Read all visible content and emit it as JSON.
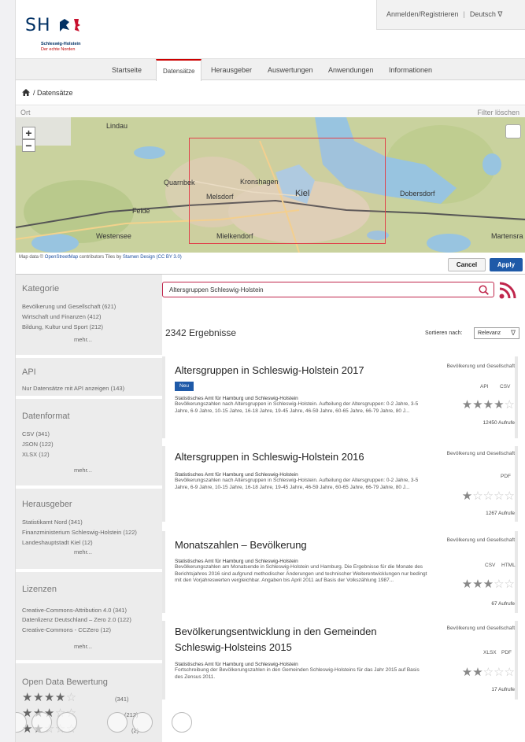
{
  "header": {
    "logo_text": "SH",
    "logo_line1": "Schleswig-Holstein",
    "logo_line2": "Der echte Norden",
    "login": "Anmelden/Registrieren",
    "separator": "|",
    "language": "Deutsch ∇"
  },
  "nav": [
    "Startseite",
    "Datensätze",
    "Herausgeber",
    "Auswertungen",
    "Anwendungen",
    "Informationen"
  ],
  "breadcrumb": "/ Datensätze",
  "map": {
    "label": "Ort",
    "clear": "Filter löschen",
    "zoom_in": "+",
    "zoom_out": "−",
    "places": [
      "Lindau",
      "Quarnbek",
      "Kronshagen",
      "Melsdorf",
      "Kiel",
      "Dobersdorf",
      "Felde",
      "Westensee",
      "Mielkendorf",
      "Martensra"
    ],
    "attribution_pre": "Map data © ",
    "attribution_osm": "OpenStreetMap",
    "attribution_mid": " contributors   Tiles by ",
    "attribution_stamen": "Stamen Design",
    "attribution_cc": " (CC BY 3.0)",
    "cancel": "Cancel",
    "apply": "Apply"
  },
  "sidebar": {
    "kategorie": {
      "title": "Kategorie",
      "items": [
        "Bevölkerung und Gesellschaft (621)",
        "Wirtschaft und Finanzen (412)",
        "Bildung, Kultur und Sport (212)"
      ],
      "more": "mehr..."
    },
    "api": {
      "title": "API",
      "items": [
        "Nur Datensätze mit API anzeigen (143)"
      ]
    },
    "datenformat": {
      "title": "Datenformat",
      "items": [
        "CSV (341)",
        "JSON (122)",
        "XLSX (12)"
      ],
      "more": "mehr..."
    },
    "herausgeber": {
      "title": "Herausgeber",
      "items": [
        "Statistikamt Nord (341)",
        "Finanzministerium Schleswig-Holstein (122)",
        "Landeshauptstadt Kiel (12)"
      ],
      "more": "mehr..."
    },
    "lizenzen": {
      "title": "Lizenzen",
      "items": [
        "Creative-Commons-Attribution 4.0 (341)",
        "Datenlizenz Deutschland – Zero 2.0 (122)",
        "Creative-Commons - CCZero (12)"
      ],
      "more": "mehr..."
    },
    "bewertung": {
      "title": "Open Data Bewertung",
      "rows": [
        {
          "stars": 4,
          "count": "(341)"
        },
        {
          "stars": 3,
          "count": "(212)"
        },
        {
          "stars": 2,
          "count": "(2)"
        }
      ]
    }
  },
  "search": {
    "value": "Altersgruppen Schleswig-Holstein"
  },
  "results_count": "2342 Ergebnisse",
  "sort": {
    "label": "Sortieren nach:",
    "value": "Relevanz",
    "arrow": "∇"
  },
  "results": [
    {
      "title": "Altersgruppen in Schleswig-Holstein 2017",
      "badge": "Neu",
      "publisher": "Statistisches Amt für Hamburg und Schleswig-Holstein",
      "description": "Bevölkerungszahlen nach Altersgruppen in Schleswig-Holstein. Aufteilung der Altersgruppen: 0-2 Jahre, 3-5 Jahre, 6-9 Jahre, 10-15 Jahre, 16-18 Jahre, 19-45 Jahre, 46-59 Jahre, 60-65 Jahre, 66-79 Jahre, 80 J...",
      "category": "Bevölkerung und Gesellschaft",
      "formats": [
        "API",
        "CSV"
      ],
      "rating": 4,
      "views": "12450 Aufrufe"
    },
    {
      "title": "Altersgruppen in Schleswig-Holstein 2016",
      "publisher": "Statistisches Amt für Hamburg und Schleswig-Holstein",
      "description": "Bevölkerungszahlen nach Altersgruppen in Schleswig-Holstein. Aufteilung der Altersgruppen: 0-2 Jahre, 3-5 Jahre, 6-9 Jahre, 10-15 Jahre, 16-18 Jahre, 19-45 Jahre, 46-59 Jahre, 60-65 Jahre, 66-79 Jahre, 80 J...",
      "category": "Bevölkerung und Gesellschaft",
      "formats": [
        "PDF"
      ],
      "rating": 1,
      "views": "1267 Aufrufe"
    },
    {
      "title": "Monatszahlen – Bevölkerung",
      "publisher": "Statistisches Amt für Hamburg und Schleswig-Holstein",
      "description": "Bevölkerungszahlen am Monatsende in Schleswig-Holstein und Hamburg. Die Ergebnisse für die Monate des Berichtsjahres 2016 sind aufgrund methodischer Änderungen und technischer Weiterentwicklungen nur bedingt mit den Vorjahreswerten vergleichbar. Angaben bis April 2011 auf Basis der Volkszählung 1987...",
      "category": "Bevölkerung und Gesellschaft",
      "formats": [
        "CSV",
        "HTML"
      ],
      "rating": 3,
      "views": "67 Aufrufe"
    },
    {
      "title": "Bevölkerungsentwicklung in den Gemeinden",
      "title2": "Schleswig-Holsteins 2015",
      "publisher": "Statistisches Amt für Hamburg und Schleswig-Holstein",
      "description": "Fortschreibung der Bevölkerungszahlen in den Gemeinden Schleswig-Holsteins für das Jahr 2015 auf Basis des Zensus 2011.",
      "category": "Bevölkerung und Gesellschaft",
      "formats": [
        "XLSX",
        "PDF"
      ],
      "rating": 2,
      "views": "17 Aufrufe"
    }
  ]
}
